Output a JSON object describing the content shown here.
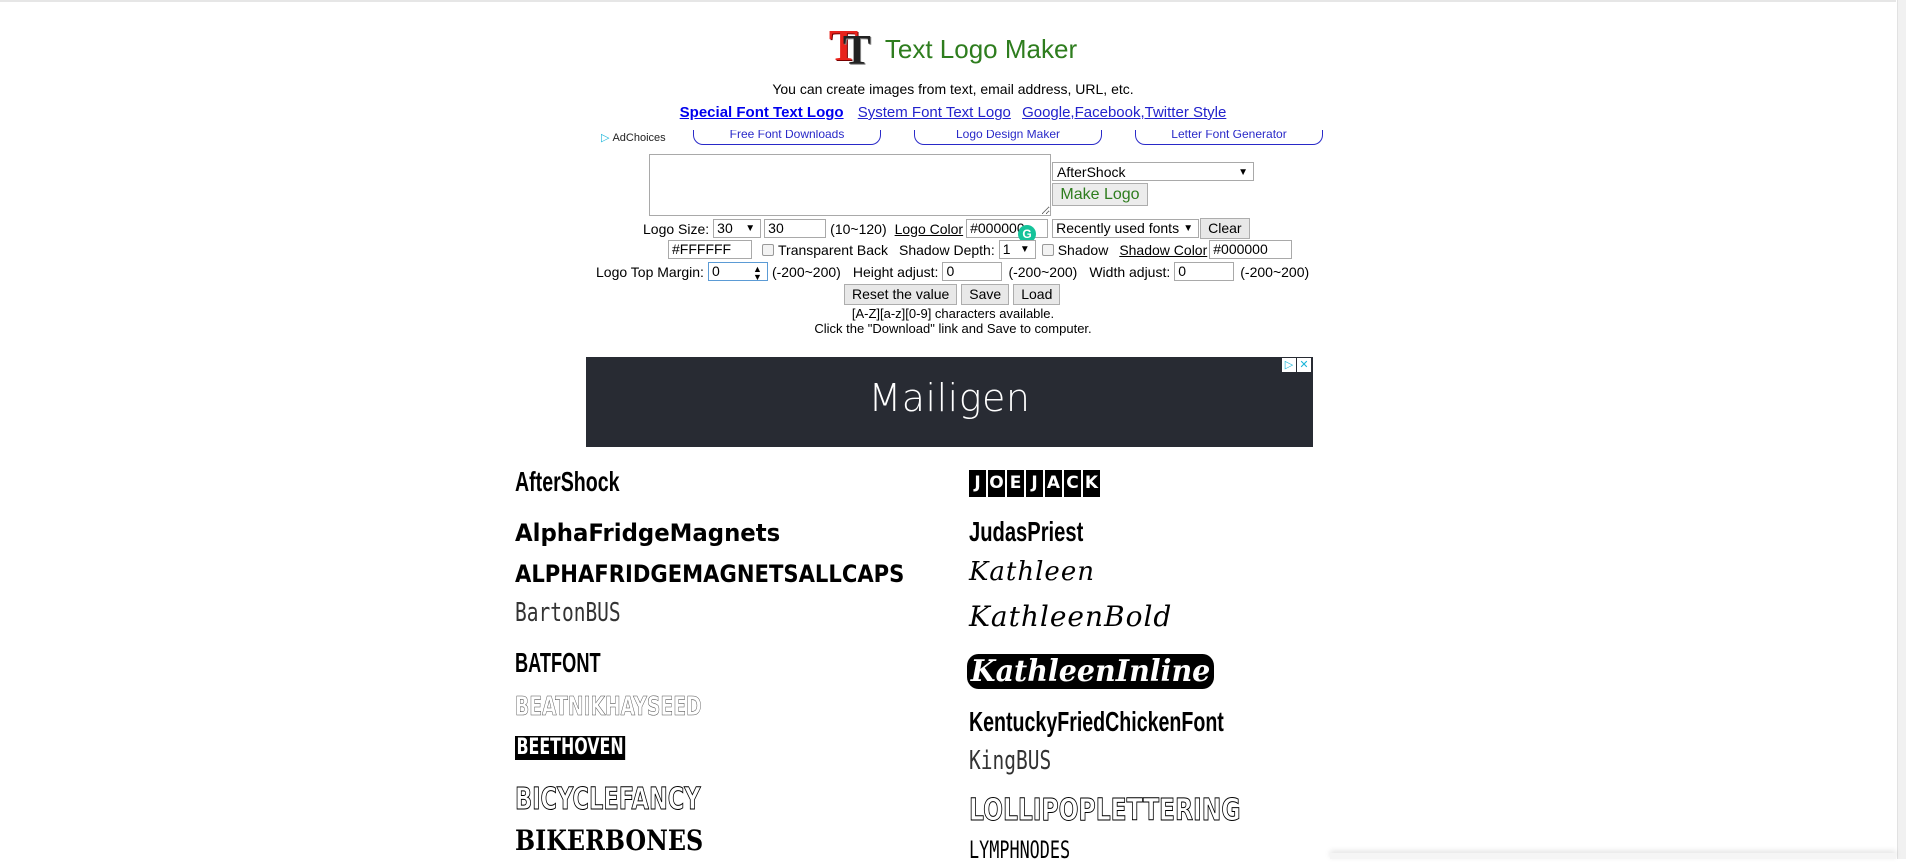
{
  "header": {
    "logo_icon": "tt-logo-icon",
    "logo_letters": [
      "T",
      "T"
    ],
    "title": "Text Logo Maker",
    "subtitle": "You can create images from text, email address, URL, etc."
  },
  "nav": {
    "links": [
      {
        "label": "Special Font Text Logo",
        "active": true
      },
      {
        "label": "System Font Text Logo",
        "active": false
      },
      {
        "label": "Google,Facebook,Twitter Style",
        "active": false
      }
    ]
  },
  "ad_links": {
    "adchoices_label": "AdChoices",
    "links": [
      "Free Font Downloads",
      "Logo Design Maker",
      "Letter Font Generator"
    ]
  },
  "editor": {
    "text_value": "",
    "font_select": "AfterShock",
    "make_logo_label": "Make Logo"
  },
  "controls": {
    "logo_size_label": "Logo Size:",
    "logo_size_select": "30",
    "logo_size_value": "30",
    "logo_size_range": "(10~120)",
    "logo_color_label": "Logo Color",
    "logo_color_value": "#000000",
    "recent_fonts_select": "Recently used fonts",
    "clear_label": "Clear",
    "background_color_value": "#FFFFFF",
    "transparent_back_label": "Transparent Back",
    "transparent_back_checked": false,
    "shadow_depth_label": "Shadow Depth:",
    "shadow_depth_select": "1",
    "shadow_label": "Shadow",
    "shadow_checked": false,
    "shadow_color_label": "Shadow Color",
    "shadow_color_value": "#000000",
    "top_margin_label": "Logo Top Margin:",
    "top_margin_value": "0",
    "top_margin_range": "(-200~200)",
    "height_adjust_label": "Height adjust:",
    "height_adjust_value": "0",
    "height_adjust_range": "(-200~200)",
    "width_adjust_label": "Width adjust:",
    "width_adjust_value": "0",
    "width_adjust_range": "(-200~200)",
    "reset_label": "Reset the value",
    "save_label": "Save",
    "load_label": "Load"
  },
  "info": {
    "line1": "[A-Z][a-z][0-9] characters available.",
    "line2": "Click the \"Download\" link and Save to computer."
  },
  "banner_ad": {
    "brand": "Mailigen"
  },
  "fonts": {
    "left": [
      "AfterShock",
      "AlphaFridgeMagnets",
      "ALPHAFRIDGEMAGNETSALLCAPS",
      "BartonBUS",
      "BATFONT",
      "BEATNIKHAYSEED",
      "BEETHOVEN",
      "BICYCLEFANCY",
      "BIKERBONES"
    ],
    "right": [
      "JOEJACK",
      "JudasPriest",
      "Kathleen",
      "KathleenBold",
      "KathleenInline",
      "KentuckyFriedChickenFont",
      "KingBUS",
      "LOLLIPOPLETTERING",
      "LYMPHNODES"
    ]
  }
}
